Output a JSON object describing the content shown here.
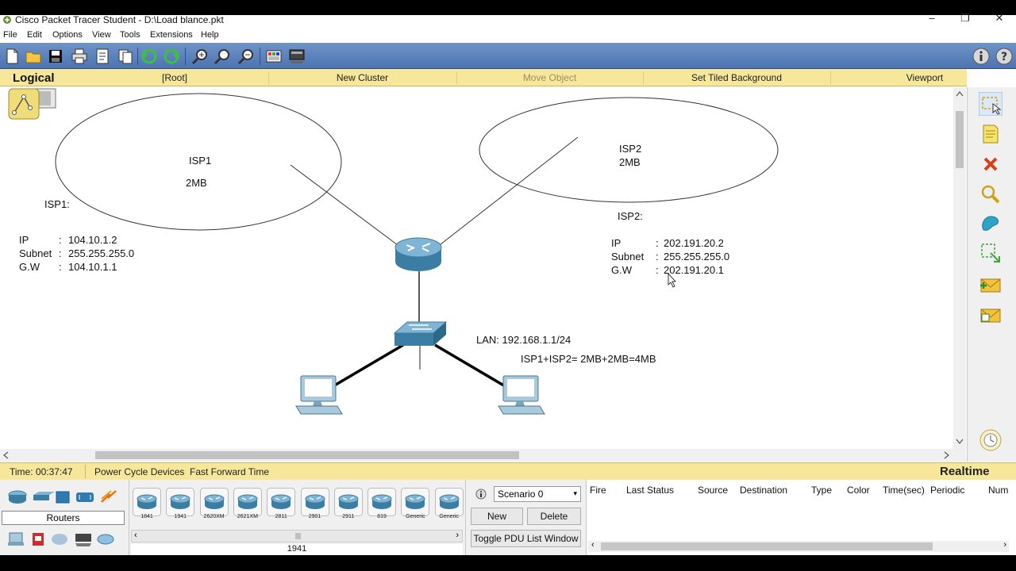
{
  "window": {
    "title": "Cisco Packet Tracer Student - D:\\Load blance.pkt",
    "minimize": "–",
    "maximize": "❐",
    "close": "✕"
  },
  "menu": [
    "File",
    "Edit",
    "Options",
    "View",
    "Tools",
    "Extensions",
    "Help"
  ],
  "workspace": {
    "tab": "Logical",
    "root": "[Root]",
    "new_cluster": "New Cluster",
    "move_object": "Move Object",
    "tiled_bg": "Set Tiled Background",
    "viewport": "Viewport"
  },
  "diagram": {
    "isp1_cloud_name": "ISP1",
    "isp1_cloud_bw": "2MB",
    "isp2_cloud_name": "ISP2",
    "isp2_cloud_bw": "2MB",
    "isp1_note": {
      "title": "ISP1:",
      "rows": [
        {
          "key": "IP",
          "sep": ":",
          "val": "104.10.1.2"
        },
        {
          "key": "Subnet",
          "sep": ":",
          "val": "255.255.255.0"
        },
        {
          "key": "G.W",
          "sep": ":",
          "val": "104.10.1.1"
        }
      ]
    },
    "isp2_note": {
      "title": "ISP2:",
      "rows": [
        {
          "key": "IP",
          "sep": ":",
          "val": "202.191.20.2"
        },
        {
          "key": "Subnet",
          "sep": ":",
          "val": "255.255.255.0"
        },
        {
          "key": "G.W",
          "sep": ":",
          "val": "202.191.20.1"
        }
      ]
    },
    "lan_note": "LAN: 192.168.1.1/24",
    "sum_note": "ISP1+ISP2= 2MB+2MB=4MB"
  },
  "status": {
    "time": "Time: 00:37:47",
    "power_cycle": "Power Cycle Devices",
    "fast_forward": "Fast Forward Time",
    "mode": "Realtime"
  },
  "device_panel": {
    "category": "Routers",
    "selected_model": "1941",
    "models": [
      "1841",
      "1941",
      "2620XM",
      "2621XM",
      "2811",
      "2901",
      "2911",
      "819",
      "Generic",
      "Generic"
    ]
  },
  "scenario": {
    "selected": "Scenario 0",
    "new": "New",
    "delete": "Delete",
    "toggle": "Toggle PDU List Window"
  },
  "pdu_columns": [
    "Fire",
    "Last Status",
    "Source",
    "Destination",
    "Type",
    "Color",
    "Time(sec)",
    "Periodic",
    "Num"
  ],
  "colors": {
    "toolbar": "#5a80bd",
    "header_yellow": "#f7e79a"
  }
}
